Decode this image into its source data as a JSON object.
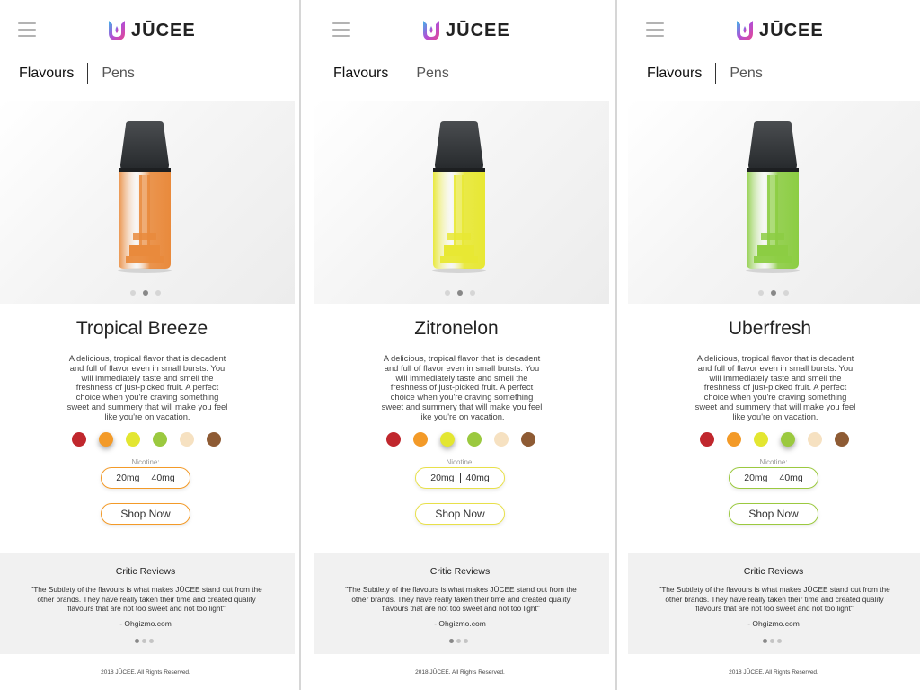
{
  "brand": {
    "logo_text": "JŪCEE",
    "logo_gradient": [
      "#3fb6e8",
      "#b14fd6",
      "#e8468e"
    ]
  },
  "nav": {
    "flavours_label": "Flavours",
    "pens_label": "Pens"
  },
  "shared": {
    "description": "A delicious, tropical flavor that is decadent and full of flavor even in small bursts. You will immediately taste and smell the freshness of just-picked fruit. A perfect choice when you're craving something sweet and summery that will make you feel like you're on vacation.",
    "nicotine_label": "Nicotine:",
    "nicotine_options": [
      "20mg",
      "40mg"
    ],
    "shop_label": "Shop Now",
    "swatch_colors": [
      "#c0272d",
      "#f39a28",
      "#e3e631",
      "#9bc93f",
      "#f6e1c1",
      "#8e5b34"
    ],
    "hero_dots": 3,
    "hero_active_dot": 1
  },
  "reviews": {
    "title": "Critic Reviews",
    "quote": "\"The Subtlety of the flavours is what makes JŪCEE stand out from the other brands. They have really taken their time and created quality flavours that are not too sweet and not too light\"",
    "source": "- Ohgizmo.com",
    "dots": 3,
    "active_dot": 0
  },
  "footer": {
    "copyright": "2018 JŪCEE. All Rights Reserved."
  },
  "screens": [
    {
      "flavour_name": "Tropical Breeze",
      "pod_color": "#e98a3c",
      "accent_color": "#f39a28",
      "selected_swatch": 1
    },
    {
      "flavour_name": "Zitronelon",
      "pod_color": "#e8e833",
      "accent_color": "#e8e04a",
      "selected_swatch": 2
    },
    {
      "flavour_name": "Uberfresh",
      "pod_color": "#8ccd43",
      "accent_color": "#9bc93f",
      "selected_swatch": 3
    }
  ]
}
